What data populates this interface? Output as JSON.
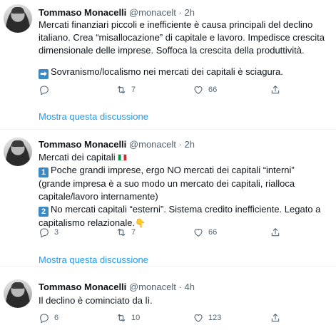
{
  "tweets": [
    {
      "author_name": "Tommaso Monacelli",
      "handle": "@monacelt",
      "separator": "·",
      "time": "2h",
      "paragraph_1": "Mercati finanziari piccoli e inefficiente è causa principali del declino italiano. Crea “misallocazione” di capitale e lavoro. Impedisce crescita dimensionale delle imprese. Soffoca la crescita della produttività.",
      "arrow_emoji": "➡",
      "paragraph_2": "Sovranismo/localismo nei mercati dei capitali è sciagura.",
      "reply_count": "",
      "retweet_count": "7",
      "like_count": "66",
      "show_thread": "Mostra questa discussione"
    },
    {
      "author_name": "Tommaso Monacelli",
      "handle": "@monacelt",
      "separator": "·",
      "time": "2h",
      "line_1": "Mercati dei capitali",
      "item_1_number": "1",
      "item_1_text": "Poche grandi imprese, ergo NO mercati dei capitali “interni” (grande impresa è a suo modo un mercato dei capitali, rialloca capitale/lavoro internamente)",
      "item_2_number": "2",
      "item_2_text": "No mercati capitali “esterni”. Sistema credito inefficiente. Legato a capitalismo relazionale.",
      "hand_emoji": "👇",
      "reply_count": "3",
      "retweet_count": "7",
      "like_count": "66",
      "show_thread": "Mostra questa discussione"
    },
    {
      "author_name": "Tommaso Monacelli",
      "handle": "@monacelt",
      "separator": "·",
      "time": "4h",
      "text": "Il declino è cominciato da lì.",
      "reply_count": "6",
      "retweet_count": "10",
      "like_count": "123"
    }
  ],
  "icons": [
    "avatar",
    "reply-icon",
    "retweet-icon",
    "like-icon",
    "share-icon",
    "flag-italy-icon"
  ],
  "colors": {
    "link": "#1d9bf0",
    "secondary_text": "#536471",
    "divider": "#eff3f4",
    "keycap_blue": "#3b88c3"
  }
}
